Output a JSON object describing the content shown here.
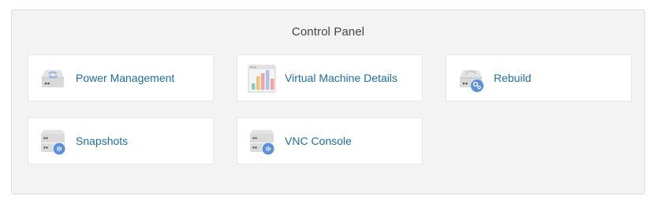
{
  "panel": {
    "title": "Control Panel",
    "tiles": [
      {
        "label": "Power Management",
        "icon": "server-refresh-icon"
      },
      {
        "label": "Virtual Machine Details",
        "icon": "bar-chart-window-icon"
      },
      {
        "label": "Rebuild",
        "icon": "server-gears-icon"
      },
      {
        "label": "Snapshots",
        "icon": "server-settings-icon"
      },
      {
        "label": "VNC Console",
        "icon": "server-settings-icon"
      }
    ]
  },
  "colors": {
    "link": "#1b6fa8",
    "panel_bg": "#f3f3f3",
    "badge_blue": "#5b8fe0"
  }
}
